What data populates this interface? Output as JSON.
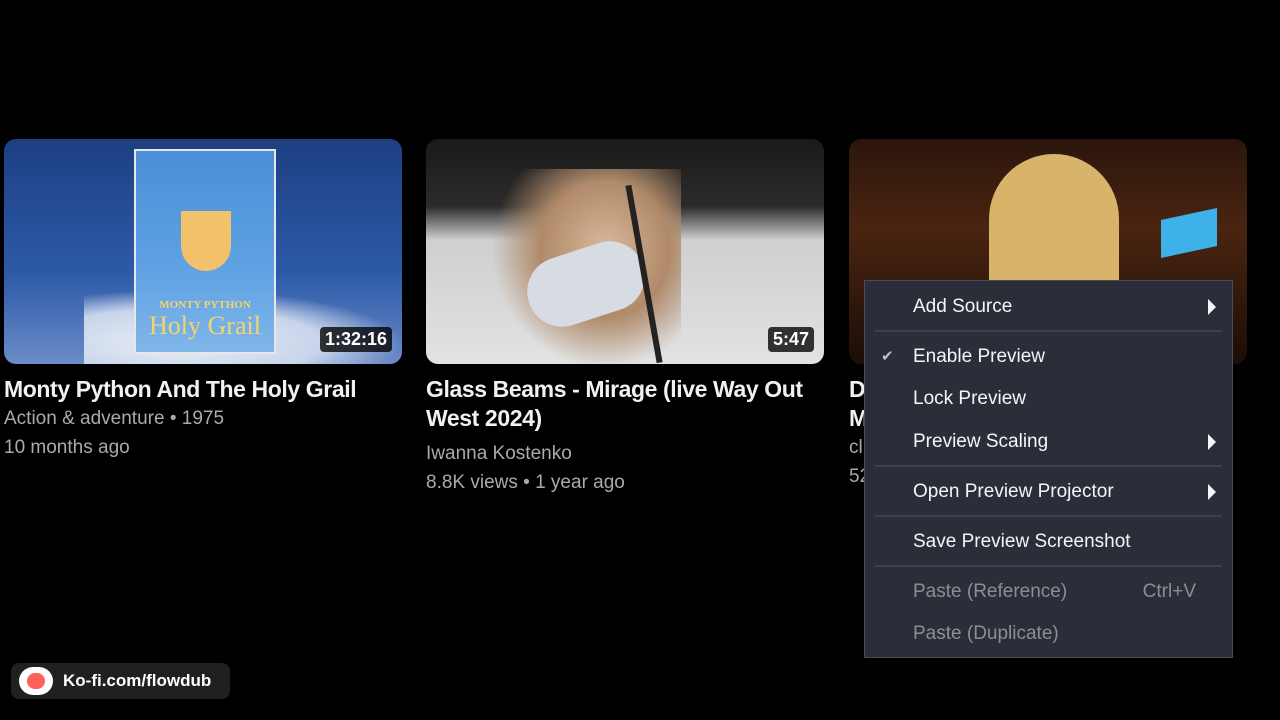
{
  "videos": [
    {
      "title": "Monty Python And The Holy Grail",
      "meta_line_1": "Action & adventure • 1975",
      "meta_line_2": "10 months ago",
      "duration": "1:32:16",
      "poster_line_1": "MONTY PYTHON",
      "poster_line_2": "Holy Grail"
    },
    {
      "title": "Glass Beams - Mirage (live Way Out West 2024)",
      "channel": "Iwanna Kostenko",
      "meta": "8.8K views • 1 year ago",
      "duration": "5:47"
    },
    {
      "title_partial_1": "D",
      "title_partial_2": "M",
      "channel_partial": "cl",
      "meta_partial": "52"
    }
  ],
  "context_menu": {
    "items": [
      {
        "label": "Add Source",
        "submenu": true
      },
      {
        "label": "Enable Preview",
        "checked": true
      },
      {
        "label": "Lock Preview"
      },
      {
        "label": "Preview Scaling",
        "submenu": true
      },
      {
        "label": "Open Preview Projector",
        "submenu": true
      },
      {
        "label": "Save Preview Screenshot"
      },
      {
        "label": "Paste (Reference)",
        "shortcut": "Ctrl+V",
        "disabled": true
      },
      {
        "label": "Paste (Duplicate)",
        "disabled": true
      }
    ],
    "check_glyph": "✔"
  },
  "kofi": {
    "text": "Ko-fi.com/flowdub",
    "icon": "kofi-cup-icon"
  }
}
